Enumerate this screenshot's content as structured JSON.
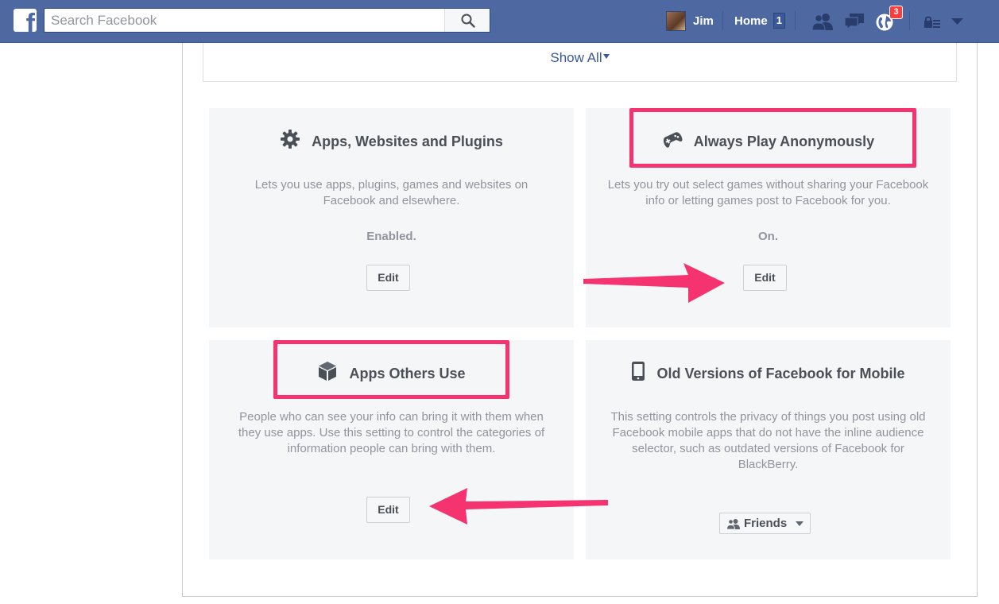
{
  "topbar": {
    "logo_letter": "f",
    "search_placeholder": "Search Facebook",
    "user_name": "Jim",
    "home_label": "Home",
    "home_count": "1",
    "notifications_count": "3",
    "icons": [
      "facebook-logo",
      "search-icon",
      "friend-requests-icon",
      "messages-icon",
      "notifications-globe-icon",
      "privacy-lock-icon",
      "account-dropdown-icon"
    ]
  },
  "show_all": {
    "label": "Show All"
  },
  "cards": {
    "apps_websites": {
      "icon": "gear-icon",
      "title": "Apps, Websites and Plugins",
      "description": "Lets you use apps, plugins, games and websites on Facebook and elsewhere.",
      "status": "Enabled.",
      "edit_label": "Edit"
    },
    "play_anonymously": {
      "icon": "gamepad-icon",
      "title": "Always Play Anonymously",
      "description": "Lets you try out select games without sharing your Facebook info or letting games post to Facebook for you.",
      "status": "On.",
      "edit_label": "Edit"
    },
    "apps_others_use": {
      "icon": "cube-icon",
      "title": "Apps Others Use",
      "description": "People who can see your info can bring it with them when they use apps. Use this setting to control the categories of information people can bring with them.",
      "edit_label": "Edit"
    },
    "old_mobile": {
      "icon": "mobile-phone-icon",
      "title": "Old Versions of Facebook for Mobile",
      "description": "This setting controls the privacy of things you post using old Facebook mobile apps that do not have the inline audience selector, such as outdated versions of Facebook for BlackBerry.",
      "audience_label": "Friends"
    }
  },
  "annotations": {
    "highlight_color": "#f53370",
    "arrow_color": "#f53370"
  },
  "colors": {
    "topbar": "#4e69a2",
    "link": "#3b5998",
    "card_bg": "#f5f6f7",
    "badge": "#fa3e3e"
  }
}
